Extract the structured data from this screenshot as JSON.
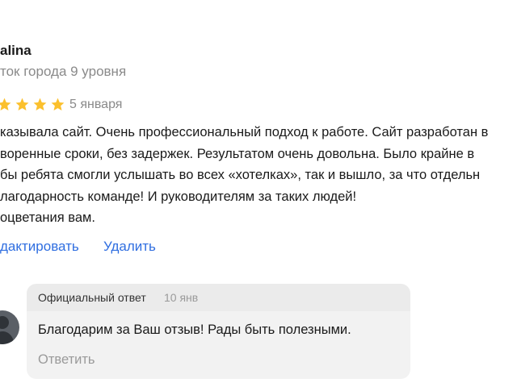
{
  "review": {
    "author": "alina",
    "level": "ток города 9 уровня",
    "rating": 5,
    "date": "5 января",
    "lines": [
      "казывала сайт. Очень профессиональный подход к работе. Сайт разработан в",
      "воренные сроки, без задержек. Результатом очень довольна. Было крайне в",
      "бы ребята смогли услышать во всех «хотелках», так и вышло, за что отдельн",
      "лагодарность команде! И руководителям за таких людей!",
      "оцветания вам."
    ],
    "actions": {
      "edit": "дактировать",
      "delete": "Удалить"
    }
  },
  "reply": {
    "label": "Официальный ответ",
    "date": "10 янв",
    "text": "Благодарим за Ваш отзыв! Рады быть полезными.",
    "reply_button": "Ответить"
  },
  "colors": {
    "star": "#fbc02d",
    "link": "#2f6ee0",
    "muted": "#8a8a8a",
    "reply_bg": "#f2f2f2"
  }
}
